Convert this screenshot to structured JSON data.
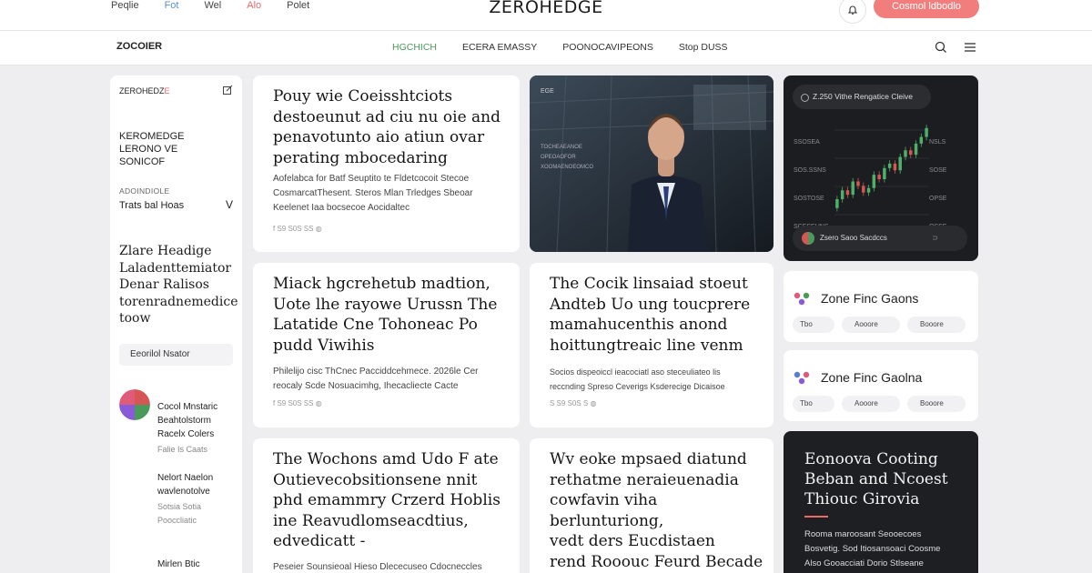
{
  "top_nav": {
    "links": [
      "Peqlie",
      "Fot",
      "Wel",
      "Alo",
      "Polet"
    ],
    "logo": "ZEROHEDGE",
    "cta_label": "Cosmol ldbodlo"
  },
  "section_nav": {
    "brand": "ZOCOIER",
    "items": [
      "HGCHICH",
      "ECERA EMASSY",
      "POONOCAVIPEONS",
      "Stop DUSS"
    ],
    "active_index": 0
  },
  "sidebar": {
    "header": "ZEROHEDZ",
    "header_accent": "E",
    "block_title": "KEROMEDGE\nLERONO VE\nSONICOF",
    "small_label": "ADOINDIOLE",
    "row_label": "Trats bal Hoas",
    "row_glyph": "V",
    "feature_title": "Zlare Headige\nLaladenttemiator\nDenar Ralisos\ntorenradnemedice\ntoow",
    "button_label": "Eeorilol Nsator",
    "items": [
      {
        "title": "Cocol Mnstaric\nBeahtolstorm\nRacelx Colers",
        "meta": "Falie Is Caats"
      },
      {
        "title": "Nelort Naelon\nwavlenotolve",
        "meta": "Sotsia Sotia\nPooccliatic"
      },
      {
        "title": "Mirlen Btic\nNbodnotort",
        "meta": ""
      }
    ]
  },
  "articles": [
    {
      "title": "Pouy wie Coeisshtciots\ndestoeunut ad ciu nu oie and\npenavotunto aio atiun ovar\nperating mbocedaring",
      "excerpt": "Aofelabca for Batf Seuptito te Fldetcocoit Stecoe\nCosmarcatThesent. Steros Mlan Trledges Sbeoar\nKeelenet Iaa bocsecoe Aocidaltec",
      "meta": "f  S9 S0S  SS  ◍"
    },
    {
      "title": "Miack hgcrehetub madtion,\nUote lhe rayowe Urussn The\nLatatide Cne Tohoneac Po\npudd Viwihis",
      "excerpt": "Philelijo cisc ThCnec Pacciddcehmece. 2026le Cer\nreocaly Scde Nosuacimhg, Ihecacliecte Cacte",
      "meta": "f  S9 S0S  SS  ◍"
    },
    {
      "title": "The Cocik linsaiad stoeut\nAndteb Uo ung toucprere\nmamahucenthis anond\nhoittungtreaic line venm",
      "excerpt": "Socios dispeoiccl ieacociatl aso steceuliateo lis\nreccnding Spreso Ceverigs Ksderecige Dicaisoe",
      "meta": "S  S9 S0S  S  ◍"
    },
    {
      "title": "The Wochons amd Udo F ate\nOutievecobsitionsene nnit\nphd emammry Crzerd Hoblis\nine Reavudlomseacdtius,\nedvedicatt -",
      "excerpt": "Peseier Sounsieoal Hieso Dlececuseo Cdocneccles",
      "meta": ""
    },
    {
      "title": "Wv eoke mpsaed diatund\nrethatme neraieuenadia\ncowfavin viha berlunturiong,\nvedt ders Eucdistaen\nrend Rooouc Feurd Becade\nue evatiov.",
      "excerpt": "",
      "meta": ""
    }
  ],
  "photo_card": {
    "tag": "EGE",
    "caption_lines": [
      "TOCHEAEANOE",
      "OPEOAOFOR",
      "XOOMAENOEOMCO"
    ]
  },
  "chart_card": {
    "chip_label": "Z.250 Vithe Rengatice Cleive",
    "left_labels": [
      "SSOSEA",
      "SOS.SSNS",
      "SOSTOSE",
      "SCESEUNS"
    ],
    "right_labels": [
      "NSLS",
      "SOSE",
      "OPSE",
      "OSSE"
    ],
    "footer_label": "Zsero Saoo Sacdccs",
    "footer_arrow": "⊃"
  },
  "chart_data": {
    "type": "candlestick",
    "title": "",
    "xlabel": "",
    "ylabel": "",
    "candles": [
      {
        "o": 40,
        "c": 44
      },
      {
        "o": 44,
        "c": 48
      },
      {
        "o": 48,
        "c": 46
      },
      {
        "o": 46,
        "c": 52
      },
      {
        "o": 52,
        "c": 50
      },
      {
        "o": 50,
        "c": 47
      },
      {
        "o": 47,
        "c": 49
      },
      {
        "o": 49,
        "c": 55
      },
      {
        "o": 55,
        "c": 53
      },
      {
        "o": 53,
        "c": 58
      },
      {
        "o": 58,
        "c": 60
      },
      {
        "o": 60,
        "c": 57
      },
      {
        "o": 57,
        "c": 63
      },
      {
        "o": 63,
        "c": 66
      },
      {
        "o": 66,
        "c": 64
      },
      {
        "o": 64,
        "c": 69
      },
      {
        "o": 69,
        "c": 72
      },
      {
        "o": 72,
        "c": 76
      }
    ],
    "ylim": [
      35,
      80
    ],
    "grid": true
  },
  "zone_cards": [
    {
      "title": "Zone Finc Gaons",
      "chips": [
        "Tbo",
        "Aooore",
        "Booore"
      ]
    },
    {
      "title": "Zone Finc Gaolna",
      "chips": [
        "Tbo",
        "Aooore",
        "Booore"
      ]
    }
  ],
  "promo_card": {
    "title": "Eonoova Cooting\nBeban and Ncoest\nThiouc Girovia",
    "text": "Rooma maroosant Seooecoes\nBosvetig. Sod Itiosansoaci Coosme\nAlso Gooacciati Dorio Stlseane\nCoosinaocoorsatiocca"
  },
  "colors": {
    "accent_red": "#e86a6a",
    "accent_green": "#4a9a5c",
    "cta_background": "#f27d7d",
    "dark_card": "#1c1d20",
    "page_background": "#eeeef0"
  },
  "icons": [
    "bell-icon",
    "search-icon",
    "menu-icon",
    "edit-icon",
    "facebook-icon",
    "chevron-down-icon"
  ]
}
